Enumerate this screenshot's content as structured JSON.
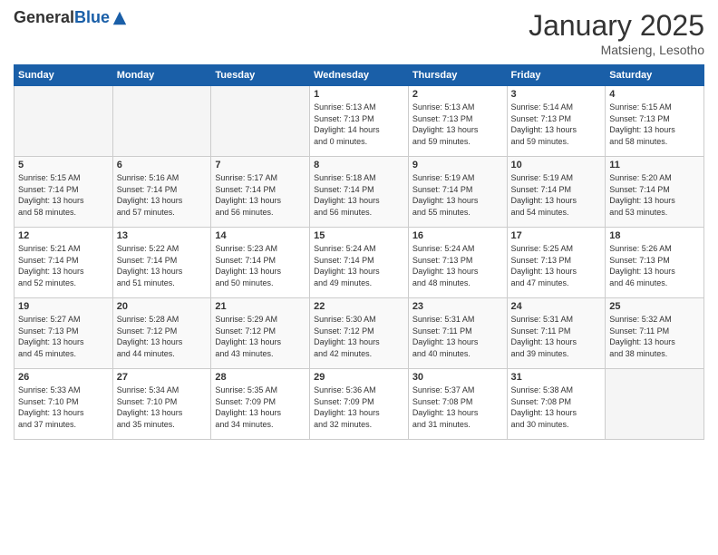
{
  "logo": {
    "general": "General",
    "blue": "Blue"
  },
  "header": {
    "title": "January 2025",
    "subtitle": "Matsieng, Lesotho"
  },
  "weekdays": [
    "Sunday",
    "Monday",
    "Tuesday",
    "Wednesday",
    "Thursday",
    "Friday",
    "Saturday"
  ],
  "weeks": [
    [
      {
        "day": "",
        "info": ""
      },
      {
        "day": "",
        "info": ""
      },
      {
        "day": "",
        "info": ""
      },
      {
        "day": "1",
        "info": "Sunrise: 5:13 AM\nSunset: 7:13 PM\nDaylight: 14 hours\nand 0 minutes."
      },
      {
        "day": "2",
        "info": "Sunrise: 5:13 AM\nSunset: 7:13 PM\nDaylight: 13 hours\nand 59 minutes."
      },
      {
        "day": "3",
        "info": "Sunrise: 5:14 AM\nSunset: 7:13 PM\nDaylight: 13 hours\nand 59 minutes."
      },
      {
        "day": "4",
        "info": "Sunrise: 5:15 AM\nSunset: 7:13 PM\nDaylight: 13 hours\nand 58 minutes."
      }
    ],
    [
      {
        "day": "5",
        "info": "Sunrise: 5:15 AM\nSunset: 7:14 PM\nDaylight: 13 hours\nand 58 minutes."
      },
      {
        "day": "6",
        "info": "Sunrise: 5:16 AM\nSunset: 7:14 PM\nDaylight: 13 hours\nand 57 minutes."
      },
      {
        "day": "7",
        "info": "Sunrise: 5:17 AM\nSunset: 7:14 PM\nDaylight: 13 hours\nand 56 minutes."
      },
      {
        "day": "8",
        "info": "Sunrise: 5:18 AM\nSunset: 7:14 PM\nDaylight: 13 hours\nand 56 minutes."
      },
      {
        "day": "9",
        "info": "Sunrise: 5:19 AM\nSunset: 7:14 PM\nDaylight: 13 hours\nand 55 minutes."
      },
      {
        "day": "10",
        "info": "Sunrise: 5:19 AM\nSunset: 7:14 PM\nDaylight: 13 hours\nand 54 minutes."
      },
      {
        "day": "11",
        "info": "Sunrise: 5:20 AM\nSunset: 7:14 PM\nDaylight: 13 hours\nand 53 minutes."
      }
    ],
    [
      {
        "day": "12",
        "info": "Sunrise: 5:21 AM\nSunset: 7:14 PM\nDaylight: 13 hours\nand 52 minutes."
      },
      {
        "day": "13",
        "info": "Sunrise: 5:22 AM\nSunset: 7:14 PM\nDaylight: 13 hours\nand 51 minutes."
      },
      {
        "day": "14",
        "info": "Sunrise: 5:23 AM\nSunset: 7:14 PM\nDaylight: 13 hours\nand 50 minutes."
      },
      {
        "day": "15",
        "info": "Sunrise: 5:24 AM\nSunset: 7:14 PM\nDaylight: 13 hours\nand 49 minutes."
      },
      {
        "day": "16",
        "info": "Sunrise: 5:24 AM\nSunset: 7:13 PM\nDaylight: 13 hours\nand 48 minutes."
      },
      {
        "day": "17",
        "info": "Sunrise: 5:25 AM\nSunset: 7:13 PM\nDaylight: 13 hours\nand 47 minutes."
      },
      {
        "day": "18",
        "info": "Sunrise: 5:26 AM\nSunset: 7:13 PM\nDaylight: 13 hours\nand 46 minutes."
      }
    ],
    [
      {
        "day": "19",
        "info": "Sunrise: 5:27 AM\nSunset: 7:13 PM\nDaylight: 13 hours\nand 45 minutes."
      },
      {
        "day": "20",
        "info": "Sunrise: 5:28 AM\nSunset: 7:12 PM\nDaylight: 13 hours\nand 44 minutes."
      },
      {
        "day": "21",
        "info": "Sunrise: 5:29 AM\nSunset: 7:12 PM\nDaylight: 13 hours\nand 43 minutes."
      },
      {
        "day": "22",
        "info": "Sunrise: 5:30 AM\nSunset: 7:12 PM\nDaylight: 13 hours\nand 42 minutes."
      },
      {
        "day": "23",
        "info": "Sunrise: 5:31 AM\nSunset: 7:11 PM\nDaylight: 13 hours\nand 40 minutes."
      },
      {
        "day": "24",
        "info": "Sunrise: 5:31 AM\nSunset: 7:11 PM\nDaylight: 13 hours\nand 39 minutes."
      },
      {
        "day": "25",
        "info": "Sunrise: 5:32 AM\nSunset: 7:11 PM\nDaylight: 13 hours\nand 38 minutes."
      }
    ],
    [
      {
        "day": "26",
        "info": "Sunrise: 5:33 AM\nSunset: 7:10 PM\nDaylight: 13 hours\nand 37 minutes."
      },
      {
        "day": "27",
        "info": "Sunrise: 5:34 AM\nSunset: 7:10 PM\nDaylight: 13 hours\nand 35 minutes."
      },
      {
        "day": "28",
        "info": "Sunrise: 5:35 AM\nSunset: 7:09 PM\nDaylight: 13 hours\nand 34 minutes."
      },
      {
        "day": "29",
        "info": "Sunrise: 5:36 AM\nSunset: 7:09 PM\nDaylight: 13 hours\nand 32 minutes."
      },
      {
        "day": "30",
        "info": "Sunrise: 5:37 AM\nSunset: 7:08 PM\nDaylight: 13 hours\nand 31 minutes."
      },
      {
        "day": "31",
        "info": "Sunrise: 5:38 AM\nSunset: 7:08 PM\nDaylight: 13 hours\nand 30 minutes."
      },
      {
        "day": "",
        "info": ""
      }
    ]
  ]
}
